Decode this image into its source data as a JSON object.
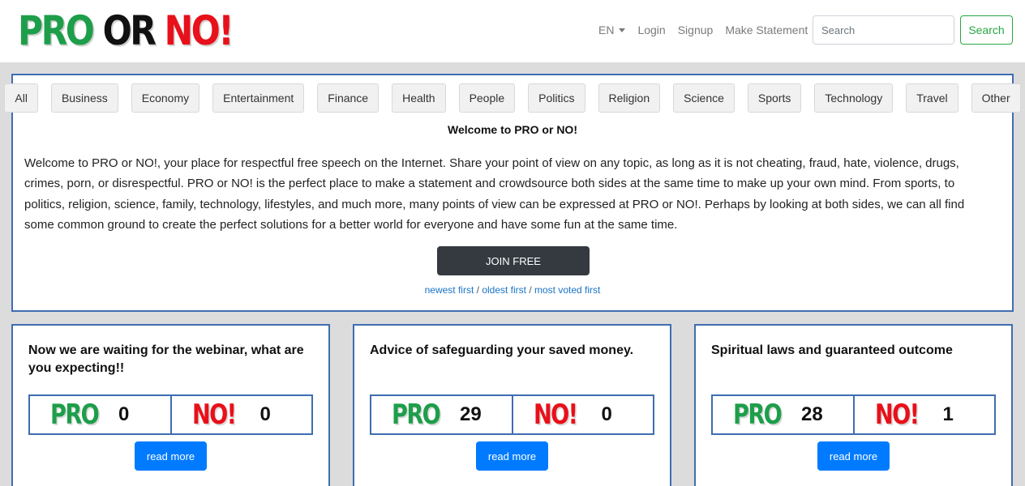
{
  "logo": {
    "pro": "PRO",
    "or": "OR",
    "no": "NO!"
  },
  "nav": {
    "language": "EN",
    "login": "Login",
    "signup": "Signup",
    "make_statement": "Make Statement",
    "search_placeholder": "Search",
    "search_button": "Search"
  },
  "categories": [
    "All",
    "Business",
    "Economy",
    "Entertainment",
    "Finance",
    "Health",
    "People",
    "Politics",
    "Religion",
    "Science",
    "Sports",
    "Technology",
    "Travel",
    "Other"
  ],
  "welcome": {
    "title": "Welcome to PRO or NO!",
    "text": "Welcome to PRO or NO!, your place for respectful free speech on the Internet. Share your point of view on any topic, as long as it is not cheating, fraud, hate, violence, drugs, crimes, porn, or disrespectful. PRO or NO! is the perfect place to make a statement and crowdsource both sides at the same time to make up your own mind. From sports, to politics, religion, science, family, technology, lifestyles, and much more, many points of view can be expressed at PRO or NO!. Perhaps by looking at both sides, we can all find some common ground to create the perfect solutions for a better world for everyone and have some fun at the same time.",
    "join_button": "JOIN FREE",
    "sort_newest": "newest first",
    "sort_oldest": "oldest first",
    "sort_most_voted": "most voted first",
    "separator": " / "
  },
  "cards": [
    {
      "title": "Now we are waiting for the webinar, what are you expecting!!",
      "pro_label": "PRO",
      "pro_count": "0",
      "no_label": "NO!",
      "no_count": "0",
      "read_more": "read more"
    },
    {
      "title": "Advice of safeguarding your saved money.",
      "pro_label": "PRO",
      "pro_count": "29",
      "no_label": "NO!",
      "no_count": "0",
      "read_more": "read more"
    },
    {
      "title": "Spiritual laws and guaranteed outcome",
      "pro_label": "PRO",
      "pro_count": "28",
      "no_label": "NO!",
      "no_count": "1",
      "read_more": "read more"
    }
  ],
  "colors": {
    "pro_green": "#1e9e4a",
    "no_red": "#e8101a",
    "border_blue": "#3f6db2",
    "link_blue": "#1a73c8",
    "button_blue": "#007bff",
    "join_dark": "#343a40",
    "search_green": "#28a745"
  }
}
